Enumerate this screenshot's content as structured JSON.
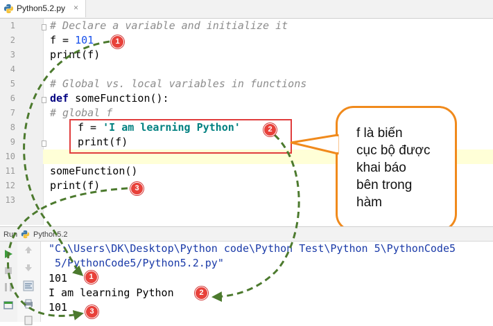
{
  "tab": {
    "filename": "Python5.2.py",
    "close": "×"
  },
  "editor": {
    "line_numbers": [
      "1",
      "2",
      "3",
      "4",
      "5",
      "6",
      "7",
      "8",
      "9",
      "10",
      "11",
      "12",
      "13"
    ],
    "lines": {
      "l1": "# Declare a variable and initialize it",
      "l2_a": "f = ",
      "l2_b": "101",
      "l3": "print(f)",
      "l5": "# Global vs. local variables in functions",
      "l6_kw": "def",
      "l6_rest": " someFunction():",
      "l7": "# global f",
      "l8_a": "f = ",
      "l8_b": "'I am learning Python'",
      "l9": "print(f)",
      "l11": "someFunction()",
      "l12": "print(f)"
    }
  },
  "badges": {
    "one": "1",
    "two": "2",
    "three": "3"
  },
  "callout": {
    "lines": [
      "f là biến",
      "cục bộ được",
      "khai báo",
      "bên trong",
      "hàm"
    ]
  },
  "run": {
    "label": "Run",
    "config_name": "Python5.2"
  },
  "console": {
    "path_line1": "\"C:\\Users\\DK\\Desktop\\Python code\\Python Test\\Python 5\\PythonCode5",
    "path_line2": " 5/PythonCode5/Python5.2.py\"",
    "out1": "101",
    "out2": "I am learning Python",
    "out3": "101"
  },
  "colors": {
    "badge": "#e8413a",
    "arrow": "#4c7a2e",
    "callout_border": "#f08a1c",
    "highlight_box": "#e03c3c"
  }
}
